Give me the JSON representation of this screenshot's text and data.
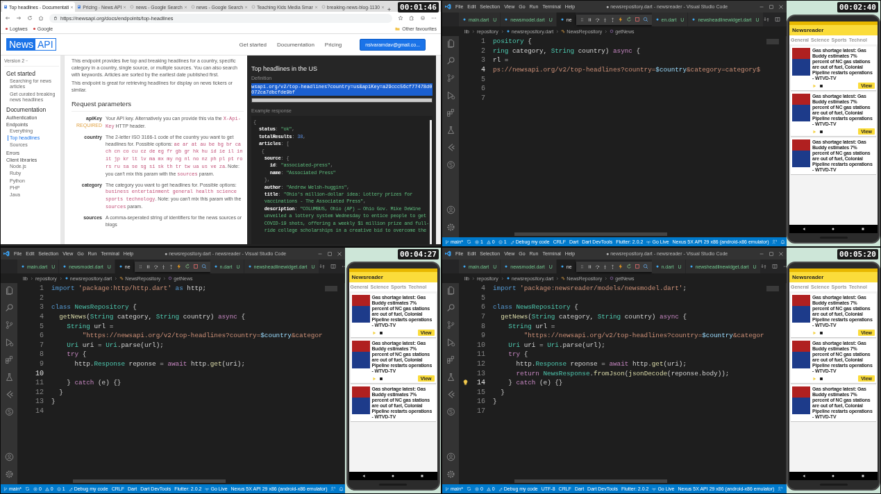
{
  "frames": [
    {
      "kind": "browser",
      "timestamp": "00:01:46",
      "browser": {
        "tabs": [
          {
            "title": "Top headlines - Documentati",
            "selected": true
          },
          {
            "title": "Pricing - News API",
            "selected": false
          },
          {
            "title": "news - Google Search",
            "selected": false
          },
          {
            "title": "news - Google Search",
            "selected": false
          },
          {
            "title": "Teaching Kids Media Smar",
            "selected": false
          },
          {
            "title": "breaking-news-blog-1130",
            "selected": false
          }
        ],
        "url": "https://newsapi.org/docs/endpoints/top-headlines",
        "bookmarks": [
          "Logiwes",
          "Google"
        ],
        "other_bookmarks": "Other favourites"
      },
      "site": {
        "logo": [
          "News",
          "API"
        ],
        "nav": [
          "Get started",
          "Documentation",
          "Pricing"
        ],
        "account": "nsivaramdav@gmail.co..."
      },
      "sidebar": {
        "version": "Version 2",
        "entries": [
          {
            "label": "Get started",
            "kind": "section",
            "selected": false
          },
          {
            "label": "Searching for news articles",
            "kind": "item",
            "selected": false
          },
          {
            "label": "Get curated breaking news headlines",
            "kind": "item",
            "selected": false
          },
          {
            "label": "Documentation",
            "kind": "section",
            "selected": false
          },
          {
            "label": "Authentication",
            "kind": "group",
            "selected": false
          },
          {
            "label": "Endpoints",
            "kind": "group",
            "selected": false
          },
          {
            "label": "Everything",
            "kind": "item",
            "selected": false
          },
          {
            "label": "Top headlines",
            "kind": "item",
            "selected": true
          },
          {
            "label": "Sources",
            "kind": "item",
            "selected": false
          },
          {
            "label": "Errors",
            "kind": "group",
            "selected": false
          },
          {
            "label": "Client libraries",
            "kind": "group",
            "selected": false
          },
          {
            "label": "Node.js",
            "kind": "item",
            "selected": false
          },
          {
            "label": "Ruby",
            "kind": "item",
            "selected": false
          },
          {
            "label": "Python",
            "kind": "item",
            "selected": false
          },
          {
            "label": "PHP",
            "kind": "item",
            "selected": false
          },
          {
            "label": "Java",
            "kind": "item",
            "selected": false
          }
        ]
      },
      "content": {
        "intro": [
          "This endpoint provides live top and breaking headlines for a country, specific category in a country, single source, or multiple sources. You can also search with keywords. Articles are sorted by the earliest date published first.",
          "This endpoint is great for retrieving headlines for display on news tickers or similar."
        ],
        "heading": "Request parameters",
        "params": [
          {
            "name": "apiKey",
            "required": "REQUIRED",
            "parts": [
              {
                "kind": "text",
                "text": "Your API key. Alternatively you can provide this via the "
              },
              {
                "kind": "code",
                "text": "X-Api-Key"
              },
              {
                "kind": "text",
                "text": " HTTP header."
              }
            ]
          },
          {
            "name": "country",
            "parts": [
              {
                "kind": "text",
                "text": "The 2-letter ISO 3166-1 code of the country you want to get headlines for. Possible options: "
              },
              {
                "kind": "code",
                "text": "ae ar at au be bg br ca ch cn co cu cz de eg fr gb gr hk hu id ie il in it jp kr lt lv ma mx my ng nl no nz ph pl pt ro rs ru sa se sg si sk th tr tw ua us ve za"
              },
              {
                "kind": "text",
                "text": ". Note: you can't mix this param with the "
              },
              {
                "kind": "code",
                "text": "sources"
              },
              {
                "kind": "text",
                "text": " param."
              }
            ]
          },
          {
            "name": "category",
            "parts": [
              {
                "kind": "text",
                "text": "The category you want to get headlines for. Possible options: "
              },
              {
                "kind": "code",
                "text": "business entertainment general health science sports technology"
              },
              {
                "kind": "text",
                "text": ". Note: you can't mix this param with the "
              },
              {
                "kind": "code",
                "text": "sources"
              },
              {
                "kind": "text",
                "text": " param."
              }
            ]
          },
          {
            "name": "sources",
            "parts": [
              {
                "kind": "text",
                "text": "A comma-seperated string of identifiers for the news sources or blogs"
              }
            ]
          }
        ]
      },
      "panel": {
        "title": "Top headlines in the US",
        "definition_label": "Definition",
        "definition": "wsapi.org/v2/top-headlines?country=us&apiKey=a29ccc56cf77478d0072ca7dbcfde9bf",
        "response_label": "Example response",
        "lines": [
          [
            {
              "text": "{",
              "kind": "punct"
            }
          ],
          [
            {
              "text": "  status",
              "kind": "key"
            },
            {
              "text": ": ",
              "kind": "punct"
            },
            {
              "text": "\"ok\"",
              "kind": "string"
            },
            {
              "text": ",",
              "kind": "punct"
            }
          ],
          [
            {
              "text": "  totalResults",
              "kind": "key"
            },
            {
              "text": ": ",
              "kind": "punct"
            },
            {
              "text": "38",
              "kind": "number"
            },
            {
              "text": ",",
              "kind": "punct"
            }
          ],
          [
            {
              "text": "  articles",
              "kind": "key"
            },
            {
              "text": ": [",
              "kind": "punct"
            }
          ],
          [
            {
              "text": "   {",
              "kind": "punct"
            }
          ],
          [
            {
              "text": "    source",
              "kind": "key"
            },
            {
              "text": ": {",
              "kind": "punct"
            }
          ],
          [
            {
              "text": "      id",
              "kind": "key"
            },
            {
              "text": ": ",
              "kind": "punct"
            },
            {
              "text": "\"associated-press\"",
              "kind": "string"
            },
            {
              "text": ",",
              "kind": "punct"
            }
          ],
          [
            {
              "text": "      name",
              "kind": "key"
            },
            {
              "text": ": ",
              "kind": "punct"
            },
            {
              "text": "\"Associated Press\"",
              "kind": "string"
            }
          ],
          [
            {
              "text": "    },",
              "kind": "punct"
            }
          ],
          [
            {
              "text": "    author",
              "kind": "key"
            },
            {
              "text": ": ",
              "kind": "punct"
            },
            {
              "text": "\"Andrew Welsh-huggins\"",
              "kind": "string"
            },
            {
              "text": ",",
              "kind": "punct"
            }
          ],
          [
            {
              "text": "    title",
              "kind": "key"
            },
            {
              "text": ": ",
              "kind": "punct"
            },
            {
              "text": "\"Ohio's million-dollar idea: Lottery prizes for",
              "kind": "string"
            }
          ],
          [
            {
              "text": "    vaccinations - The Associated Press\"",
              "kind": "string"
            },
            {
              "text": ",",
              "kind": "punct"
            }
          ],
          [
            {
              "text": "    description",
              "kind": "key"
            },
            {
              "text": ": ",
              "kind": "punct"
            },
            {
              "text": "\"COLUMBUS, Ohio (AP) — Ohio Gov. Mike DeWine",
              "kind": "string"
            }
          ],
          [
            {
              "text": "    unveiled a lottery system Wednesday to entice people to get",
              "kind": "string"
            }
          ],
          [
            {
              "text": "    COVID-19 shots, offering a weekly $1 million prize and full-",
              "kind": "string"
            }
          ],
          [
            {
              "text": "    ride college scholarships in a creative bid to overcome the",
              "kind": "string"
            }
          ]
        ]
      }
    },
    {
      "kind": "editor",
      "timestamp": "00:02:40",
      "menu": [
        "File",
        "Edit",
        "Selection",
        "View",
        "Go",
        "Run",
        "Terminal",
        "Help"
      ],
      "title": "● newsrepository.dart - newsreader - Visual Studio Code",
      "tabs": [
        {
          "label": "main.dart",
          "status": "U",
          "selected": false
        },
        {
          "label": "newsmodel.dart",
          "status": "U",
          "selected": false
        },
        {
          "label": "ne",
          "selected": true
        },
        {
          "label": "en.dart",
          "status": "U",
          "selected": false
        },
        {
          "label": "newsheadlinewidget.dart",
          "status": "U",
          "selected": false
        }
      ],
      "breadcrumb": [
        "lib",
        "repository",
        "newsrepository.dart",
        "NewsRepository",
        "getNews"
      ],
      "lines": [
        {
          "n": "1",
          "current": false,
          "tokens": [
            {
              "text": "pository",
              "kind": "type"
            },
            {
              "text": " {",
              "kind": "plain"
            }
          ]
        },
        {
          "n": "2",
          "current": false,
          "tokens": [
            {
              "text": "ring",
              "kind": "type"
            },
            {
              "text": " category, ",
              "kind": "plain"
            },
            {
              "text": "String",
              "kind": "type"
            },
            {
              "text": " country) ",
              "kind": "plain"
            },
            {
              "text": "async",
              "kind": "control"
            },
            {
              "text": " {",
              "kind": "plain"
            }
          ]
        },
        {
          "n": "3",
          "current": false,
          "tokens": [
            {
              "text": "rl =",
              "kind": "plain"
            }
          ]
        },
        {
          "n": "4",
          "current": true,
          "tokens": [
            {
              "text": "ps://newsapi.org/v2/top-headlines?country=",
              "kind": "string"
            },
            {
              "text": "$country",
              "kind": "variable"
            },
            {
              "text": "&category=category$",
              "kind": "string"
            }
          ]
        },
        {
          "n": "5",
          "current": false
        },
        {
          "n": "6",
          "current": false
        },
        {
          "n": "7",
          "current": false
        }
      ],
      "status": [
        {
          "kind": "branch",
          "text": "main*"
        },
        {
          "kind": "sync"
        },
        {
          "kind": "errors",
          "text": "1"
        },
        {
          "kind": "warnings",
          "text": "0"
        },
        {
          "kind": "info",
          "text": "1"
        },
        {
          "kind": "debug",
          "text": "Debug my code"
        },
        {
          "kind": "text",
          "text": "CRLF"
        },
        {
          "kind": "text",
          "text": "Dart"
        },
        {
          "kind": "text",
          "text": "Dart DevTools"
        },
        {
          "kind": "text",
          "text": "Flutter: 2.0.2"
        },
        {
          "kind": "live",
          "text": "Go Live"
        },
        {
          "kind": "text",
          "text": "Nexus 5X API 29 x86 (android-x86 emulator)"
        }
      ],
      "phone": {
        "title": "Newsreader",
        "tabs": [
          "General",
          "Science",
          "Sports",
          "Technol"
        ],
        "cards": [
          {
            "headline": "Gas shortage latest: Gas Buddy estimates 7% percent of NC gas stations are out of fuel, Colonial Pipeline restarts operations - WTVD-TV",
            "button": "View"
          },
          {
            "headline": "Gas shortage latest: Gas Buddy estimates 7% percent of NC gas stations are out of fuel, Colonial Pipeline restarts operations - WTVD-TV",
            "button": "View"
          },
          {
            "headline": "Gas shortage latest: Gas Buddy estimates 7% percent of NC gas stations are out of fuel, Colonial Pipeline restarts operations - WTVD-TV"
          }
        ]
      }
    },
    {
      "kind": "editor",
      "timestamp": "00:04:27",
      "menu": [
        "File",
        "Edit",
        "Selection",
        "View",
        "Go",
        "Run",
        "Terminal",
        "Help"
      ],
      "title": "● newsrepository.dart - newsreader - Visual Studio Code",
      "tabs": [
        {
          "label": "main.dart",
          "status": "U",
          "selected": false
        },
        {
          "label": "newsmodel.dart",
          "status": "U",
          "selected": false
        },
        {
          "label": "ne",
          "selected": true
        },
        {
          "label": "n.dart",
          "status": "U",
          "selected": false
        },
        {
          "label": "newsheadlinewidget.dart",
          "status": "U",
          "selected": false
        }
      ],
      "breadcrumb": [
        "lib",
        "repository",
        "newsrepository.dart",
        "NewsRepository",
        "getNews"
      ],
      "lines": [
        {
          "n": "1",
          "current": false,
          "tokens": [
            {
              "text": "import ",
              "kind": "keyword"
            },
            {
              "text": "'package:http/http.dart'",
              "kind": "string"
            },
            {
              "text": " as",
              "kind": "keyword"
            },
            {
              "text": " http;",
              "kind": "plain"
            }
          ]
        },
        {
          "n": "2",
          "current": false
        },
        {
          "n": "3",
          "current": false,
          "tokens": [
            {
              "text": "class ",
              "kind": "keyword"
            },
            {
              "text": "NewsRepository",
              "kind": "type"
            },
            {
              "text": " {",
              "kind": "plain"
            }
          ]
        },
        {
          "n": "4",
          "current": false,
          "tokens": [
            {
              "text": "  getNews",
              "kind": "function"
            },
            {
              "text": "(",
              "kind": "plain"
            },
            {
              "text": "String",
              "kind": "type"
            },
            {
              "text": " category, ",
              "kind": "plain"
            },
            {
              "text": "String",
              "kind": "type"
            },
            {
              "text": " country) ",
              "kind": "plain"
            },
            {
              "text": "async",
              "kind": "control"
            },
            {
              "text": " {",
              "kind": "plain"
            }
          ]
        },
        {
          "n": "5",
          "current": false,
          "tokens": [
            {
              "text": "    String",
              "kind": "type"
            },
            {
              "text": " url =",
              "kind": "plain"
            }
          ]
        },
        {
          "n": "6",
          "current": false,
          "tokens": [
            {
              "text": "        \"https://newsapi.org/v2/top-headlines?country=",
              "kind": "string"
            },
            {
              "text": "$country",
              "kind": "variable"
            },
            {
              "text": "&categor",
              "kind": "string"
            }
          ]
        },
        {
          "n": "7",
          "current": false,
          "tokens": [
            {
              "text": "    Uri",
              "kind": "type"
            },
            {
              "text": " uri = ",
              "kind": "plain"
            },
            {
              "text": "Uri",
              "kind": "type"
            },
            {
              "text": ".parse(url);",
              "kind": "plain"
            }
          ]
        },
        {
          "n": "8",
          "current": false,
          "tokens": [
            {
              "text": "    try",
              "kind": "control"
            },
            {
              "text": " {",
              "kind": "plain"
            }
          ]
        },
        {
          "n": "9",
          "current": false,
          "tokens": [
            {
              "text": "      http.",
              "kind": "plain"
            },
            {
              "text": "Response",
              "kind": "type"
            },
            {
              "text": " reponse = ",
              "kind": "plain"
            },
            {
              "text": "await",
              "kind": "control"
            },
            {
              "text": " http.",
              "kind": "plain"
            },
            {
              "text": "get",
              "kind": "function"
            },
            {
              "text": "(uri);",
              "kind": "plain"
            }
          ]
        },
        {
          "n": "10",
          "current": true
        },
        {
          "n": "11",
          "current": false,
          "tokens": [
            {
              "text": "    } ",
              "kind": "plain"
            },
            {
              "text": "catch",
              "kind": "control"
            },
            {
              "text": " (e) {}",
              "kind": "plain"
            }
          ]
        },
        {
          "n": "12",
          "current": false,
          "tokens": [
            {
              "text": "  }",
              "kind": "plain"
            }
          ]
        },
        {
          "n": "13",
          "current": false,
          "tokens": [
            {
              "text": "}",
              "kind": "plain"
            }
          ]
        },
        {
          "n": "14",
          "current": false
        }
      ],
      "status": [
        {
          "kind": "branch",
          "text": "main*"
        },
        {
          "kind": "sync"
        },
        {
          "kind": "errors",
          "text": "0"
        },
        {
          "kind": "warnings",
          "text": "0"
        },
        {
          "kind": "info",
          "text": "1"
        },
        {
          "kind": "debug",
          "text": "Debug my code"
        },
        {
          "kind": "text",
          "text": "CRLF"
        },
        {
          "kind": "text",
          "text": "Dart"
        },
        {
          "kind": "text",
          "text": "Dart DevTools"
        },
        {
          "kind": "text",
          "text": "Flutter: 2.0.2"
        },
        {
          "kind": "live",
          "text": "Go Live"
        },
        {
          "kind": "text",
          "text": "Nexus 5X API 29 x86 (android-x86 emulator)"
        }
      ],
      "phone": {
        "title": "Newsreader",
        "tabs": [
          "General",
          "Science",
          "Sports",
          "Technol"
        ],
        "cards": [
          {
            "headline": "Gas shortage latest: Gas Buddy estimates 7% percent of NC gas stations are out of fuel, Colonial Pipeline restarts operations - WTVD-TV",
            "button": "View"
          },
          {
            "headline": "Gas shortage latest: Gas Buddy estimates 7% percent of NC gas stations are out of fuel, Colonial Pipeline restarts operations - WTVD-TV",
            "button": "View"
          },
          {
            "headline": "Gas shortage latest: Gas Buddy estimates 7% percent of NC gas stations are out of fuel, Colonial Pipeline restarts operations - WTVD-TV"
          }
        ]
      }
    },
    {
      "kind": "editor",
      "timestamp": "00:05:20",
      "menu": [
        "File",
        "Edit",
        "Selection",
        "View",
        "Go",
        "Run",
        "Terminal",
        "Help"
      ],
      "title": "● newsrepository.dart - newsreader - Visual Studio Code",
      "tabs": [
        {
          "label": "main.dart",
          "status": "U",
          "selected": false
        },
        {
          "label": "newsmodel.dart",
          "status": "U",
          "selected": false
        },
        {
          "label": "ne",
          "selected": true
        },
        {
          "label": "n.dart",
          "status": "U",
          "selected": false
        },
        {
          "label": "newsheadlinewidget.dart",
          "status": "U",
          "selected": false
        }
      ],
      "breadcrumb": [
        "lib",
        "repository",
        "newsrepository.dart",
        "NewsRepository",
        "getNews"
      ],
      "lines": [
        {
          "n": "4",
          "current": false,
          "lightbulb": false,
          "tokens": [
            {
              "text": "import ",
              "kind": "keyword"
            },
            {
              "text": "'package:newsreader/models/newsmodel.dart'",
              "kind": "string"
            },
            {
              "text": ";",
              "kind": "plain"
            }
          ]
        },
        {
          "n": "5",
          "current": false,
          "lightbulb": false
        },
        {
          "n": "6",
          "current": false,
          "lightbulb": false,
          "tokens": [
            {
              "text": "class ",
              "kind": "keyword"
            },
            {
              "text": "NewsRepository",
              "kind": "type"
            },
            {
              "text": " {",
              "kind": "plain"
            }
          ]
        },
        {
          "n": "7",
          "current": false,
          "lightbulb": false,
          "tokens": [
            {
              "text": "  getNews",
              "kind": "function"
            },
            {
              "text": "(",
              "kind": "plain"
            },
            {
              "text": "String",
              "kind": "type"
            },
            {
              "text": " category, ",
              "kind": "plain"
            },
            {
              "text": "String",
              "kind": "type"
            },
            {
              "text": " country) ",
              "kind": "plain"
            },
            {
              "text": "async",
              "kind": "control"
            },
            {
              "text": " {",
              "kind": "plain"
            }
          ]
        },
        {
          "n": "8",
          "current": false,
          "lightbulb": false,
          "tokens": [
            {
              "text": "    String",
              "kind": "type"
            },
            {
              "text": " url =",
              "kind": "plain"
            }
          ]
        },
        {
          "n": "9",
          "current": false,
          "lightbulb": false,
          "tokens": [
            {
              "text": "        \"https://newsapi.org/v2/top-headlines?country=",
              "kind": "string"
            },
            {
              "text": "$country",
              "kind": "variable"
            },
            {
              "text": "&categor",
              "kind": "string"
            }
          ]
        },
        {
          "n": "10",
          "current": false,
          "lightbulb": false,
          "tokens": [
            {
              "text": "    Uri",
              "kind": "type"
            },
            {
              "text": " uri = ",
              "kind": "plain"
            },
            {
              "text": "Uri",
              "kind": "type"
            },
            {
              "text": ".parse(url);",
              "kind": "plain"
            }
          ]
        },
        {
          "n": "11",
          "current": false,
          "lightbulb": false,
          "tokens": [
            {
              "text": "    try",
              "kind": "control"
            },
            {
              "text": " {",
              "kind": "plain"
            }
          ]
        },
        {
          "n": "12",
          "current": false,
          "lightbulb": false,
          "tokens": [
            {
              "text": "      http.",
              "kind": "plain"
            },
            {
              "text": "Response",
              "kind": "type"
            },
            {
              "text": " reponse = ",
              "kind": "plain"
            },
            {
              "text": "await",
              "kind": "control"
            },
            {
              "text": " http.",
              "kind": "plain"
            },
            {
              "text": "get",
              "kind": "function"
            },
            {
              "text": "(uri);",
              "kind": "plain"
            }
          ]
        },
        {
          "n": "13",
          "current": false,
          "lightbulb": false,
          "tokens": [
            {
              "text": "      return ",
              "kind": "control"
            },
            {
              "text": "NewsResponse",
              "kind": "type"
            },
            {
              "text": ".",
              "kind": "plain"
            },
            {
              "text": "fromJson",
              "kind": "function"
            },
            {
              "text": "(",
              "kind": "plain"
            },
            {
              "text": "jsonDecode",
              "kind": "function"
            },
            {
              "text": "(reponse.body));",
              "kind": "plain"
            }
          ]
        },
        {
          "n": "14",
          "current": true,
          "lightbulb": true,
          "tokens": [
            {
              "text": "    } ",
              "kind": "plain"
            },
            {
              "text": "catch",
              "kind": "control"
            },
            {
              "text": " (e) {}",
              "kind": "plain"
            }
          ]
        },
        {
          "n": "15",
          "current": false,
          "lightbulb": false,
          "tokens": [
            {
              "text": "  }",
              "kind": "plain"
            }
          ]
        },
        {
          "n": "16",
          "current": false,
          "lightbulb": false,
          "tokens": [
            {
              "text": "}",
              "kind": "plain"
            }
          ]
        },
        {
          "n": "17",
          "current": false,
          "lightbulb": false
        }
      ],
      "status": [
        {
          "kind": "branch",
          "text": "main*"
        },
        {
          "kind": "sync"
        },
        {
          "kind": "errors",
          "text": "0"
        },
        {
          "kind": "warnings",
          "text": "0"
        },
        {
          "kind": "debug",
          "text": "Debug my code"
        },
        {
          "kind": "text",
          "text": "UTF-8"
        },
        {
          "kind": "text",
          "text": "CRLF"
        },
        {
          "kind": "text",
          "text": "Dart"
        },
        {
          "kind": "text",
          "text": "Dart DevTools"
        },
        {
          "kind": "text",
          "text": "Flutter: 2.0.2"
        },
        {
          "kind": "live",
          "text": "Go Live"
        },
        {
          "kind": "text",
          "text": "Nexus 5X API 29 x86 (android-x86 emulator)"
        }
      ],
      "phone": {
        "title": "Newsreader",
        "tabs": [
          "General",
          "Science",
          "Sports",
          "Technol"
        ],
        "cards": [
          {
            "headline": "Gas shortage latest: Gas Buddy estimates 7% percent of NC gas stations are out of fuel, Colonial Pipeline restarts operations - WTVD-TV",
            "button": "View"
          },
          {
            "headline": "Gas shortage latest: Gas Buddy estimates 7% percent of NC gas stations are out of fuel, Colonial Pipeline restarts operations - WTVD-TV",
            "button": "View"
          },
          {
            "headline": "Gas shortage latest: Gas Buddy estimates 7% percent of NC gas stations are out of fuel, Colonial Pipeline restarts operations - WTVD-TV"
          }
        ]
      }
    }
  ]
}
